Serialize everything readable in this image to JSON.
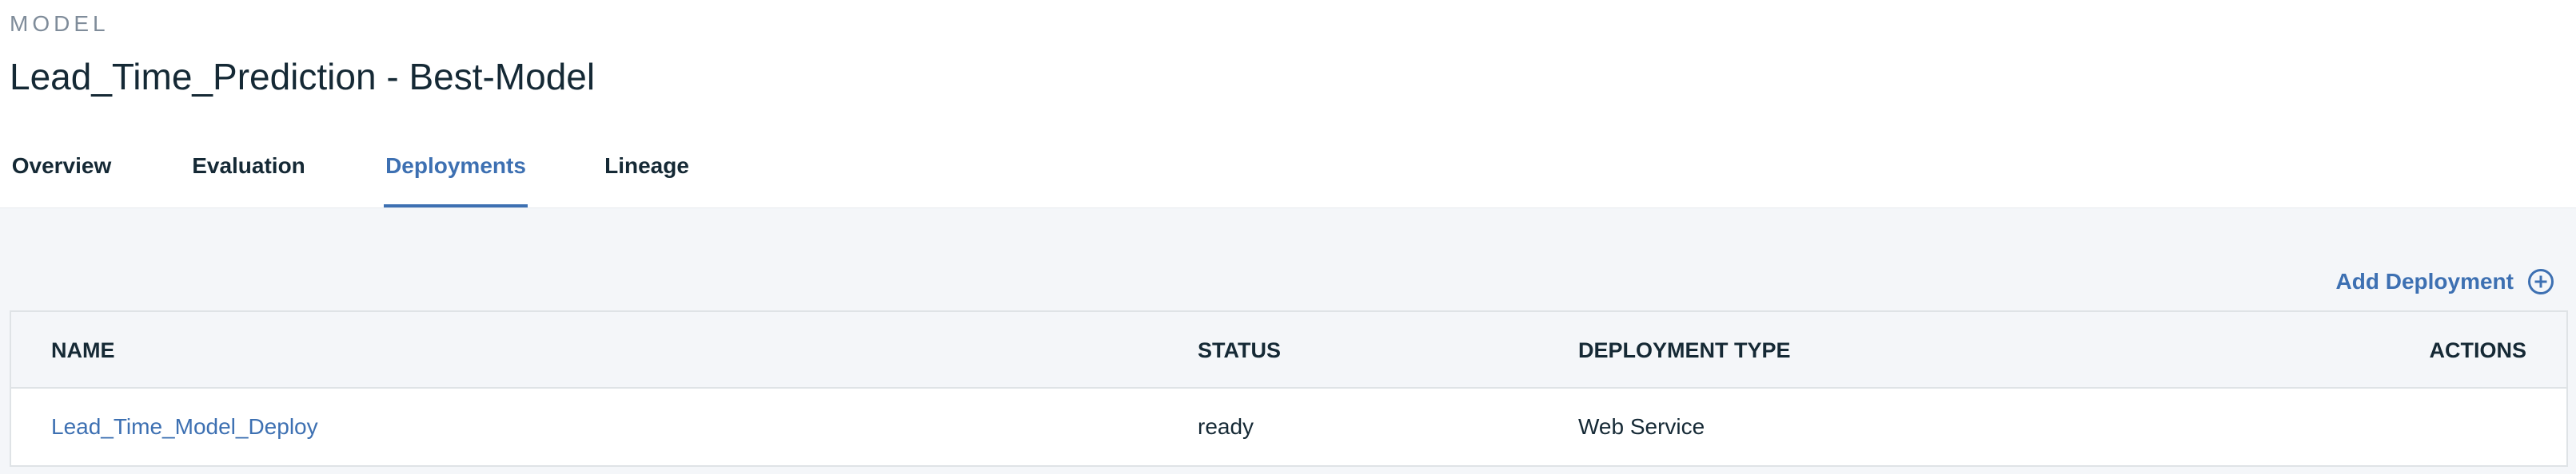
{
  "header": {
    "eyebrow": "MODEL",
    "title": "Lead_Time_Prediction - Best-Model"
  },
  "tabs": [
    {
      "label": "Overview",
      "active": false
    },
    {
      "label": "Evaluation",
      "active": false
    },
    {
      "label": "Deployments",
      "active": true
    },
    {
      "label": "Lineage",
      "active": false
    }
  ],
  "toolbar": {
    "add_label": "Add Deployment",
    "add_icon": "plus-circle-icon"
  },
  "table": {
    "columns": [
      "NAME",
      "STATUS",
      "DEPLOYMENT TYPE",
      "ACTIONS"
    ],
    "rows": [
      {
        "name": "Lead_Time_Model_Deploy",
        "status": "ready",
        "type": "Web Service",
        "actions": ""
      }
    ]
  },
  "colors": {
    "accent": "#3d70b2",
    "text": "#152935",
    "muted": "#7f8c9a",
    "background": "#f4f6f9",
    "border": "#dfe3e6"
  }
}
